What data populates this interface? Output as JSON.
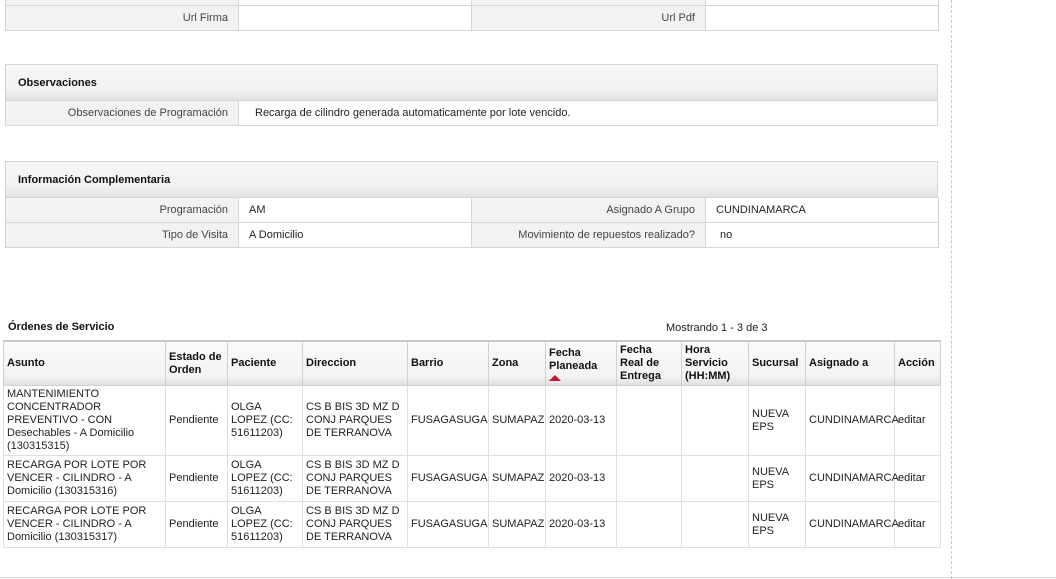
{
  "top_table": {
    "url_firma_label": "Url Firma",
    "url_firma_value": "",
    "url_pdf_label": "Url Pdf",
    "url_pdf_value": ""
  },
  "observaciones": {
    "title": "Observaciones",
    "label": "Observaciones de Programación",
    "value": "Recarga de cilindro generada automaticamente por lote vencido."
  },
  "info": {
    "title": "Información Complementaria",
    "programacion_label": "Programación",
    "programacion_value": "AM",
    "grupo_label": "Asignado A Grupo",
    "grupo_value": "CUNDINAMARCA",
    "visita_label": "Tipo de Visita",
    "visita_value": "A Domicilio",
    "repuestos_label": "Movimiento de repuestos realizado?",
    "repuestos_value": "no"
  },
  "orders": {
    "title": "Órdenes de Servicio",
    "count_text": "Mostrando 1 - 3 de 3",
    "columns": {
      "asunto": "Asunto",
      "estado": "Estado de Orden",
      "paciente": "Paciente",
      "direccion": "Direccion",
      "barrio": "Barrio",
      "zona": "Zona",
      "fecha_planeada": "Fecha Planeada",
      "fecha_real": "Fecha Real de Entrega",
      "hora_servicio": "Hora Servicio",
      "hora_formato": "(HH:MM)",
      "sucursal": "Sucursal",
      "asignado": "Asignado a",
      "accion": "Acción"
    },
    "rows": [
      {
        "asunto": "MANTENIMIENTO CONCENTRADOR PREVENTIVO - CON Desechables - A Domicilio (130315315)",
        "estado": "Pendiente",
        "paciente": "OLGA LOPEZ (CC: 51611203)",
        "direccion": "CS B BIS 3D MZ D CONJ PARQUES DE TERRANOVA",
        "barrio": "FUSAGASUGA",
        "zona": "SUMAPAZ",
        "fecha_planeada": "2020-03-13",
        "fecha_real": "",
        "hora": "",
        "sucursal": "NUEVA EPS",
        "asignado": "CUNDINAMARCA",
        "accion": "editar"
      },
      {
        "asunto": "RECARGA POR LOTE POR VENCER - CILINDRO - A Domicilio (130315316)",
        "estado": "Pendiente",
        "paciente": "OLGA LOPEZ (CC: 51611203)",
        "direccion": "CS B BIS 3D MZ D CONJ PARQUES DE TERRANOVA",
        "barrio": "FUSAGASUGA",
        "zona": "SUMAPAZ",
        "fecha_planeada": "2020-03-13",
        "fecha_real": "",
        "hora": "",
        "sucursal": "NUEVA EPS",
        "asignado": "CUNDINAMARCA",
        "accion": "editar"
      },
      {
        "asunto": "RECARGA POR LOTE POR VENCER - CILINDRO - A Domicilio (130315317)",
        "estado": "Pendiente",
        "paciente": "OLGA LOPEZ (CC: 51611203)",
        "direccion": "CS B BIS 3D MZ D CONJ PARQUES DE TERRANOVA",
        "barrio": "FUSAGASUGA",
        "zona": "SUMAPAZ",
        "fecha_planeada": "2020-03-13",
        "fecha_real": "",
        "hora": "",
        "sucursal": "NUEVA EPS",
        "asignado": "CUNDINAMARCA",
        "accion": "editar"
      }
    ]
  },
  "colors": {
    "sort_arrow": "#c8102e",
    "border": "#d6d6d6",
    "label_bg": "#f2f2f2"
  }
}
